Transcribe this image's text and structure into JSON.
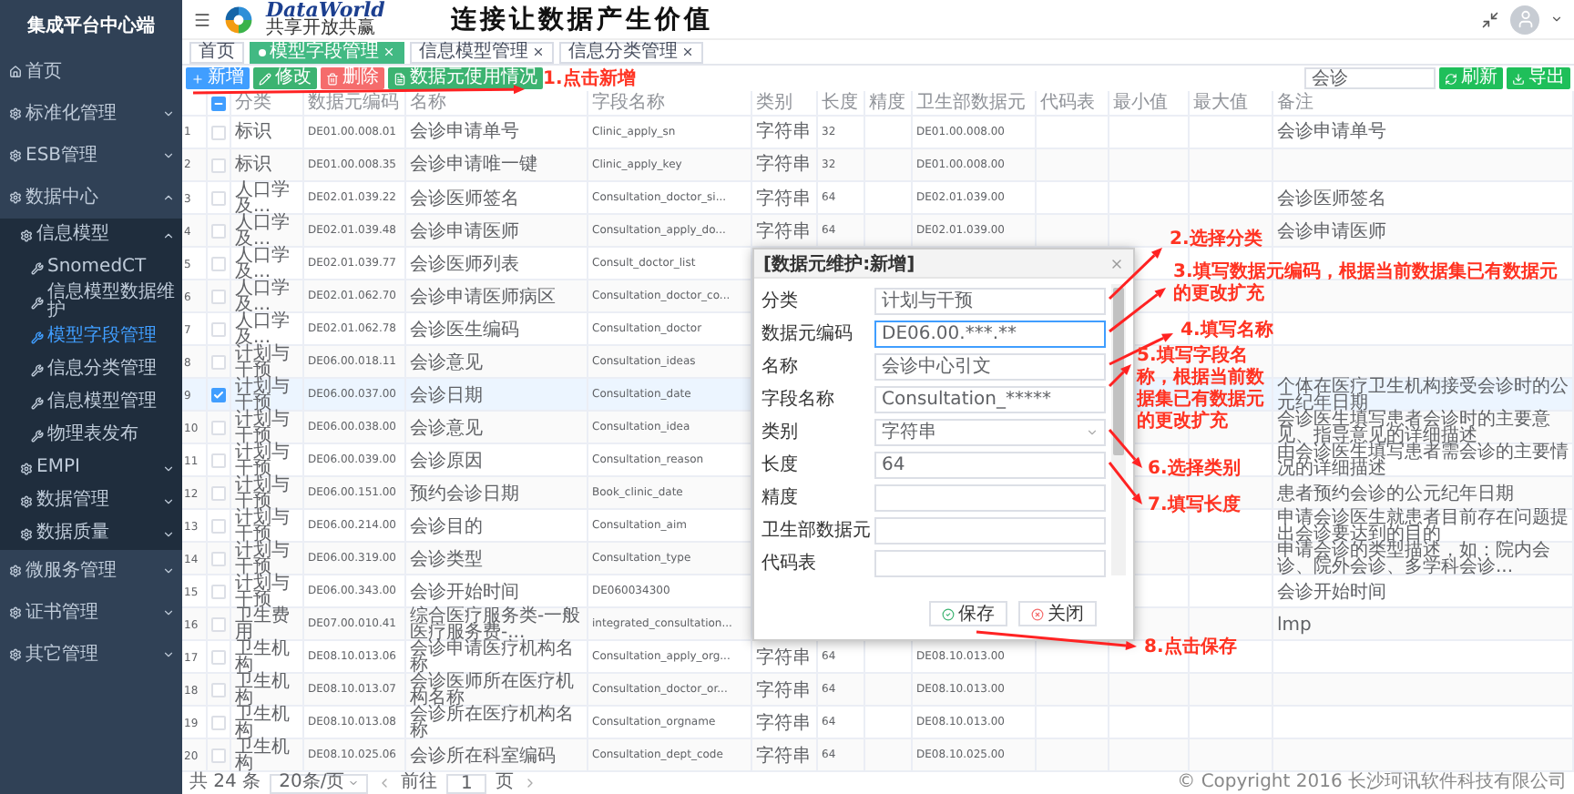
{
  "sidebar": {
    "title": "集成平台中心端",
    "items": [
      {
        "label": "首页"
      },
      {
        "label": "标准化管理",
        "expanded": false
      },
      {
        "label": "ESB管理",
        "expanded": false
      },
      {
        "label": "数据中心",
        "expanded": true,
        "children": [
          {
            "label": "信息模型",
            "expanded": true,
            "children": [
              {
                "label": "SnomedCT",
                "selected": false
              },
              {
                "label": "信息模型数据维护",
                "selected": false
              },
              {
                "label": "模型字段管理",
                "selected": true
              },
              {
                "label": "信息分类管理",
                "selected": false
              },
              {
                "label": "信息模型管理",
                "selected": false
              },
              {
                "label": "物理表发布",
                "selected": false
              }
            ]
          },
          {
            "label": "EMPI",
            "expanded": false
          },
          {
            "label": "数据管理",
            "expanded": false
          },
          {
            "label": "数据质量",
            "expanded": false
          }
        ]
      },
      {
        "label": "微服务管理",
        "expanded": false
      },
      {
        "label": "证书管理",
        "expanded": false
      },
      {
        "label": "其它管理",
        "expanded": false
      }
    ]
  },
  "header": {
    "logo_name": "DataWorld",
    "logo_tagline": "共享开放共赢",
    "slogan": "连接让数据产生价值"
  },
  "tabs": [
    {
      "label": "首页",
      "selected": false,
      "closable": false
    },
    {
      "label": "模型字段管理",
      "selected": true,
      "closable": true
    },
    {
      "label": "信息模型管理",
      "selected": false,
      "closable": true
    },
    {
      "label": "信息分类管理",
      "selected": false,
      "closable": true
    }
  ],
  "toolbar": {
    "buttons": [
      {
        "label": "新增",
        "kind": "add"
      },
      {
        "label": "修改",
        "kind": "edit"
      },
      {
        "label": "删除",
        "kind": "delete"
      },
      {
        "label": "数据元使用情况",
        "kind": "usage"
      }
    ],
    "search": {
      "value": "会诊"
    },
    "right_buttons": [
      {
        "label": "刷新",
        "kind": "refresh"
      },
      {
        "label": "导出",
        "kind": "export"
      }
    ]
  },
  "table": {
    "select_all_partial": true,
    "columns": [
      "分类",
      "数据元编码",
      "名称",
      "字段名称",
      "类别",
      "长度",
      "精度",
      "卫生部数据元",
      "代码表",
      "最小值",
      "最大值",
      "备注"
    ],
    "rows": [
      {
        "index": "1",
        "checked": false,
        "category": "标识",
        "code": "DE01.00.008.01",
        "name": "会诊申请单号",
        "field_name": "Clinic_apply_sn",
        "type": "字符串",
        "length": "32",
        "moh_element": "DE01.00.008.00",
        "remark": "会诊申请单号"
      },
      {
        "index": "2",
        "checked": false,
        "category": "标识",
        "code": "DE01.00.008.35",
        "name": "会诊申请唯一键",
        "field_name": "Clinic_apply_key",
        "type": "字符串",
        "length": "32",
        "moh_element": "DE01.00.008.00"
      },
      {
        "index": "3",
        "checked": false,
        "category": "人口学及...",
        "code": "DE02.01.039.22",
        "name": "会诊医师签名",
        "field_name": "Consultation_doctor_si...",
        "type": "字符串",
        "length": "64",
        "moh_element": "DE02.01.039.00",
        "remark": "会诊医师签名"
      },
      {
        "index": "4",
        "checked": false,
        "category": "人口学及...",
        "code": "DE02.01.039.48",
        "name": "会诊申请医师",
        "field_name": "Consultation_apply_do...",
        "type": "字符串",
        "length": "64",
        "moh_element": "DE02.01.039.00",
        "remark": "会诊申请医师"
      },
      {
        "index": "5",
        "checked": false,
        "category": "人口学及...",
        "code": "DE02.01.039.77",
        "name": "会诊医师列表",
        "field_name": "Consult_doctor_list"
      },
      {
        "index": "6",
        "checked": false,
        "category": "人口学及...",
        "code": "DE02.01.062.70",
        "name": "会诊申请医师病区",
        "field_name": "Consultation_doctor_co..."
      },
      {
        "index": "7",
        "checked": false,
        "category": "人口学及...",
        "code": "DE02.01.062.78",
        "name": "会诊医生编码",
        "field_name": "Consultation_doctor"
      },
      {
        "index": "8",
        "checked": false,
        "category": "计划与干预",
        "code": "DE06.00.018.11",
        "name": "会诊意见",
        "field_name": "Consultation_ideas"
      },
      {
        "index": "9",
        "checked": true,
        "category": "计划与干预",
        "code": "DE06.00.037.00",
        "name": "会诊日期",
        "field_name": "Consultation_date",
        "remark": "个体在医疗卫生机构接受会诊时的公元纪年日期"
      },
      {
        "index": "10",
        "checked": false,
        "category": "计划与干预",
        "code": "DE06.00.038.00",
        "name": "会诊意见",
        "field_name": "Consultation_idea",
        "remark": "会诊医生填写患者会诊时的主要意见、指导意见的详细描述"
      },
      {
        "index": "11",
        "checked": false,
        "category": "计划与干预",
        "code": "DE06.00.039.00",
        "name": "会诊原因",
        "field_name": "Consultation_reason",
        "remark": "由会诊医生填写患者需会诊的主要情况的详细描述"
      },
      {
        "index": "12",
        "checked": false,
        "category": "计划与干预",
        "code": "DE06.00.151.00",
        "name": "预约会诊日期",
        "field_name": "Book_clinic_date",
        "remark": "患者预约会诊的公元纪年日期"
      },
      {
        "index": "13",
        "checked": false,
        "category": "计划与干预",
        "code": "DE06.00.214.00",
        "name": "会诊目的",
        "field_name": "Consultation_aim",
        "remark": "申请会诊医生就患者目前存在问题提出会诊要达到的目的"
      },
      {
        "index": "14",
        "checked": false,
        "category": "计划与干预",
        "code": "DE06.00.319.00",
        "name": "会诊类型",
        "field_name": "Consultation_type",
        "remark": "申请会诊的类型描述，如：院内会诊、院外会诊、多学科会诊..."
      },
      {
        "index": "15",
        "checked": false,
        "category": "计划与干预",
        "code": "DE06.00.343.00",
        "name": "会诊开始时间",
        "field_name": "DE060034300",
        "remark": "会诊开始时间"
      },
      {
        "index": "16",
        "checked": false,
        "category": "卫生费用",
        "code": "DE07.00.010.41",
        "name": "综合医疗服务类-一般医疗服务费-...",
        "field_name": "integrated_consultation...",
        "remark": "lmp"
      },
      {
        "index": "17",
        "checked": false,
        "category": "卫生机构",
        "code": "DE08.10.013.06",
        "name": "会诊申请医疗机构名称",
        "field_name": "Consultation_apply_org...",
        "type": "字符串",
        "length": "64",
        "moh_element": "DE08.10.013.00"
      },
      {
        "index": "18",
        "checked": false,
        "category": "卫生机构",
        "code": "DE08.10.013.07",
        "name": "会诊医师所在医疗机构名称",
        "field_name": "Consultation_doctor_or...",
        "type": "字符串",
        "length": "64",
        "moh_element": "DE08.10.013.00"
      },
      {
        "index": "19",
        "checked": false,
        "category": "卫生机构",
        "code": "DE08.10.013.08",
        "name": "会诊所在医疗机构名称",
        "field_name": "Consultation_orgname",
        "type": "字符串",
        "length": "64",
        "moh_element": "DE08.10.013.00"
      },
      {
        "index": "20",
        "checked": false,
        "category": "卫生机构",
        "code": "DE08.10.025.06",
        "name": "会诊所在科室编码",
        "field_name": "Consultation_dept_code",
        "type": "字符串",
        "length": "64",
        "moh_element": "DE08.10.025.00"
      }
    ]
  },
  "pagination": {
    "total": "共 24 条",
    "page_size": "20条/页",
    "goto_label": "前往",
    "page": "1",
    "page_unit": "页"
  },
  "copyright": "© Copyright 2016 长沙珂讯软件科技有限公司",
  "dialog": {
    "title": "[数据元维护:新增]",
    "fields": [
      {
        "label": "分类",
        "value": "计划与干预",
        "kind": "text",
        "focused": false
      },
      {
        "label": "数据元编码",
        "value": "DE06.00.***.**",
        "kind": "text",
        "focused": true
      },
      {
        "label": "名称",
        "value": "会诊中心引文",
        "kind": "text",
        "focused": false
      },
      {
        "label": "字段名称",
        "value": "Consultation_*****",
        "kind": "text",
        "focused": false
      },
      {
        "label": "类别",
        "value": "字符串",
        "kind": "select",
        "focused": false
      },
      {
        "label": "长度",
        "value": "64",
        "kind": "text",
        "focused": false
      },
      {
        "label": "精度",
        "kind": "text",
        "focused": false
      },
      {
        "label": "卫生部数据元",
        "kind": "text",
        "focused": false
      },
      {
        "label": "代码表",
        "kind": "text",
        "focused": false
      }
    ],
    "buttons": [
      {
        "label": "保存",
        "kind": "save"
      },
      {
        "label": "关闭",
        "kind": "close"
      }
    ]
  },
  "annotations": [
    {
      "text": "1.点击新增"
    },
    {
      "text": "2.选择分类"
    },
    {
      "text": "3.填写数据元编码，根据当前数据集已有数据元的更改扩充"
    },
    {
      "text": "4.填写名称"
    },
    {
      "text": "5.填写字段名称，根据当前数据集已有数据元的更改扩充"
    },
    {
      "text": "6.选择类别"
    },
    {
      "text": "7.填写长度"
    },
    {
      "text": "8.点击保存"
    }
  ]
}
